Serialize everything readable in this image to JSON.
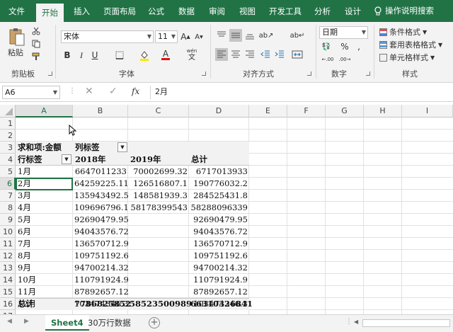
{
  "ribbon_tabs": [
    "文件",
    "开始",
    "插入",
    "页面布局",
    "公式",
    "数据",
    "审阅",
    "视图",
    "开发工具",
    "分析",
    "设计"
  ],
  "active_tab": "开始",
  "tell_me": "操作说明搜索",
  "clipboard": {
    "paste_label": "粘贴",
    "group_label": "剪贴板"
  },
  "font": {
    "name": "宋体",
    "size": "11",
    "group_label": "字体",
    "wen_label": "wén"
  },
  "alignment": {
    "group_label": "对齐方式"
  },
  "number": {
    "format": "日期",
    "group_label": "数字"
  },
  "styles": {
    "conditional": "条件格式",
    "table_format": "套用表格格式",
    "cell_styles": "单元格样式",
    "group_label": "样式"
  },
  "formula_bar": {
    "name_box": "A6",
    "fx": "fx",
    "content": "2月"
  },
  "columns": [
    "A",
    "B",
    "C",
    "D",
    "E",
    "F",
    "G",
    "H",
    "I"
  ],
  "selected_column": "A",
  "row_numbers": [
    "1",
    "2",
    "3",
    "4",
    "5",
    "6",
    "7",
    "8",
    "9",
    "10",
    "11",
    "12",
    "13",
    "14",
    "15",
    "16",
    "17",
    "18"
  ],
  "selected_row": "6",
  "pivot": {
    "header_row3": {
      "a": "求和项:金额",
      "b": "列标签"
    },
    "header_row4": {
      "a": "行标签",
      "b": "2018年",
      "c": "2019年",
      "d": "总计"
    },
    "rows": [
      {
        "label": "1月",
        "y2018": "6647011233",
        "y2019": "70002699.32",
        "total": "6717013933"
      },
      {
        "label": "2月",
        "y2018": "64259225.11",
        "y2019": "126516807.1",
        "total": "190776032.2"
      },
      {
        "label": "3月",
        "y2018": "135943492.5",
        "y2019": "148581939.3",
        "total": "284525431.8"
      },
      {
        "label": "4月",
        "y2018": "109696796.1",
        "y2019": "58178399543",
        "total": "58288096339"
      },
      {
        "label": "5月",
        "y2018": "92690479.95",
        "y2019": "",
        "total": "92690479.95"
      },
      {
        "label": "6月",
        "y2018": "94043576.72",
        "y2019": "",
        "total": "94043576.72"
      },
      {
        "label": "7月",
        "y2018": "136570712.9",
        "y2019": "",
        "total": "136570712.9"
      },
      {
        "label": "8月",
        "y2018": "109751192.6",
        "y2019": "",
        "total": "109751192.6"
      },
      {
        "label": "9月",
        "y2018": "94700214.32",
        "y2019": "",
        "total": "94700214.32"
      },
      {
        "label": "10月",
        "y2018": "110791924.9",
        "y2019": "",
        "total": "110791924.9"
      },
      {
        "label": "11月",
        "y2018": "87892657.12",
        "y2019": "",
        "total": "87892657.12"
      },
      {
        "label": "12月",
        "y2018": "103474346.3",
        "y2019": "",
        "total": "103474346.3"
      }
    ],
    "total_row": {
      "label": "总计",
      "y2018": "7786825852",
      "y2019": "58523500989",
      "total": "66310326841"
    }
  },
  "sheet_tabs": [
    "Sheet4",
    "30万行数据"
  ],
  "active_sheet": "Sheet4",
  "colors": {
    "accent": "#217346",
    "ribbon_bg": "#f3f3f3"
  }
}
